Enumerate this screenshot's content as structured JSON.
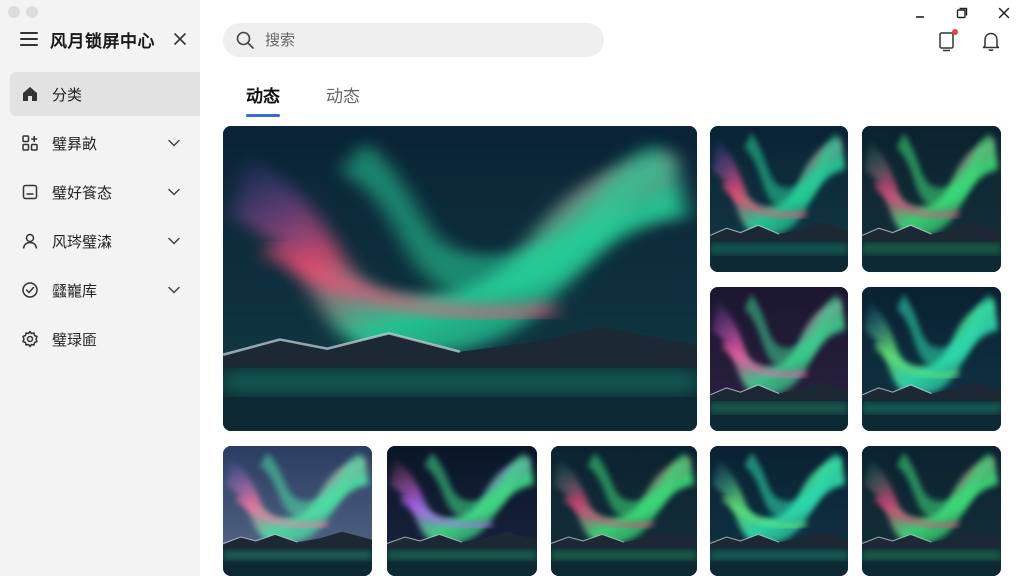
{
  "app": {
    "title": "风月锁屏中心"
  },
  "sidebar": {
    "items": [
      {
        "label": "分类",
        "icon": "home-icon",
        "active": true,
        "expandable": false
      },
      {
        "label": "璧昪畝",
        "icon": "apps-icon",
        "expandable": true
      },
      {
        "label": "璧好篒态",
        "icon": "note-icon",
        "expandable": true
      },
      {
        "label": "风琌璧潹",
        "icon": "user-icon",
        "expandable": true
      },
      {
        "label": "瓥巃库",
        "icon": "check-circle-icon",
        "expandable": true
      },
      {
        "label": "璧琭匬",
        "icon": "gear-icon",
        "expandable": false
      }
    ]
  },
  "search": {
    "placeholder": "搜索",
    "value": ""
  },
  "tabs": [
    {
      "label": "动态",
      "active": true
    },
    {
      "label": "动态",
      "active": false
    }
  ],
  "gallery": {
    "tiles": [
      {
        "name": "aurora-featured",
        "palette": "teal-pink"
      },
      {
        "name": "aurora-2",
        "palette": "teal-pink"
      },
      {
        "name": "aurora-3",
        "palette": "green-pink"
      },
      {
        "name": "aurora-4",
        "palette": "pink-violet"
      },
      {
        "name": "aurora-5",
        "palette": "teal-green"
      },
      {
        "name": "aurora-6",
        "palette": "dusk-pink"
      },
      {
        "name": "aurora-7",
        "palette": "violet-green"
      },
      {
        "name": "aurora-8",
        "palette": "green-pink"
      },
      {
        "name": "aurora-9",
        "palette": "teal-green"
      },
      {
        "name": "aurora-10",
        "palette": "green-pink"
      }
    ]
  },
  "colors": {
    "accent": "#2f6fd6",
    "notification": "#e5483b",
    "sidebar_bg": "#f3f3f3",
    "active_item_bg": "#e2e2e2"
  }
}
